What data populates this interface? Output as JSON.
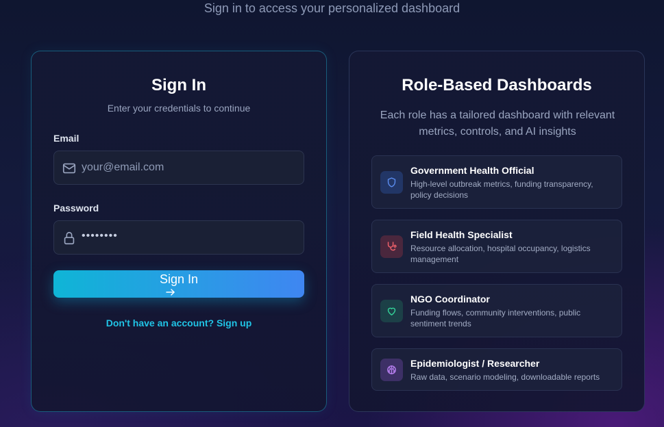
{
  "header": {
    "subtitle": "Sign in to access your personalized dashboard"
  },
  "signin": {
    "title": "Sign In",
    "subtitle": "Enter your credentials to continue",
    "email_label": "Email",
    "email_placeholder": "your@email.com",
    "password_label": "Password",
    "password_value": "••••••••",
    "button_label": "Sign In",
    "signup_link": "Don't have an account? Sign up"
  },
  "roles": {
    "title": "Role-Based Dashboards",
    "description": "Each role has a tailored dashboard with relevant metrics, controls, and AI insights",
    "items": [
      {
        "title": "Government Health Official",
        "description": "High-level outbreak metrics, funding transparency, policy decisions",
        "icon": "shield-icon",
        "color": "#5b8def"
      },
      {
        "title": "Field Health Specialist",
        "description": "Resource allocation, hospital occupancy, logistics management",
        "icon": "stethoscope-icon",
        "color": "#f0626b"
      },
      {
        "title": "NGO Coordinator",
        "description": "Funding flows, community interventions, public sentiment trends",
        "icon": "heart-icon",
        "color": "#34d399"
      },
      {
        "title": "Epidemiologist / Researcher",
        "description": "Raw data, scenario modeling, downloadable reports",
        "icon": "brain-icon",
        "color": "#b77ff0"
      }
    ]
  }
}
